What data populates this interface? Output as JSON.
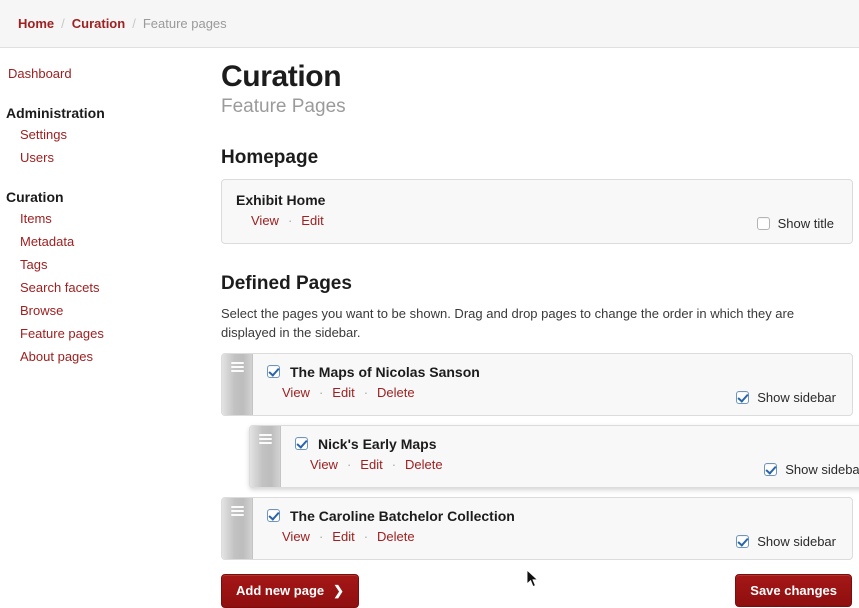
{
  "breadcrumb": {
    "items": [
      {
        "label": "Home",
        "current": false
      },
      {
        "label": "Curation",
        "current": false
      },
      {
        "label": "Feature pages",
        "current": true
      }
    ],
    "separator": "/"
  },
  "sidebar": {
    "dashboard_label": "Dashboard",
    "groups": [
      {
        "title": "Administration",
        "items": [
          {
            "label": "Settings"
          },
          {
            "label": "Users"
          }
        ]
      },
      {
        "title": "Curation",
        "items": [
          {
            "label": "Items"
          },
          {
            "label": "Metadata"
          },
          {
            "label": "Tags"
          },
          {
            "label": "Search facets"
          },
          {
            "label": "Browse"
          },
          {
            "label": "Feature pages"
          },
          {
            "label": "About pages"
          }
        ]
      }
    ]
  },
  "header": {
    "title": "Curation",
    "subtitle": "Feature Pages"
  },
  "homepage_section": {
    "heading": "Homepage",
    "item": {
      "title": "Exhibit Home",
      "links": [
        {
          "label": "View"
        },
        {
          "label": "Edit"
        }
      ],
      "separator": "·",
      "checkbox": {
        "label": "Show title",
        "checked": false
      }
    }
  },
  "defined_pages_section": {
    "heading": "Defined Pages",
    "description": "Select the pages you want to be shown. Drag and drop pages to change the order in which they are displayed in the sidebar.",
    "separator": "·",
    "rows": [
      {
        "title": "The Maps of Nicolas Sanson",
        "enabled": true,
        "dragging": false,
        "links": [
          {
            "label": "View"
          },
          {
            "label": "Edit"
          },
          {
            "label": "Delete"
          }
        ],
        "sidebar_checkbox": {
          "label": "Show sidebar",
          "checked": true
        }
      },
      {
        "title": "Nick's Early Maps",
        "enabled": true,
        "dragging": true,
        "links": [
          {
            "label": "View"
          },
          {
            "label": "Edit"
          },
          {
            "label": "Delete"
          }
        ],
        "sidebar_checkbox": {
          "label": "Show sidebar",
          "checked": true
        }
      },
      {
        "title": "The Caroline Batchelor Collection",
        "enabled": true,
        "dragging": false,
        "links": [
          {
            "label": "View"
          },
          {
            "label": "Edit"
          },
          {
            "label": "Delete"
          }
        ],
        "sidebar_checkbox": {
          "label": "Show sidebar",
          "checked": true
        }
      }
    ]
  },
  "actions": {
    "add_page_label": "Add new page",
    "add_page_chevron": "❯",
    "save_label": "Save changes"
  },
  "colors": {
    "link_red": "#9e2020",
    "button_red": "#9b1414",
    "panel_bg": "#f8f8f8",
    "panel_border": "#dcdcdc",
    "checkbox_blue": "#2a64ad",
    "muted_text": "#9b9b9b"
  }
}
